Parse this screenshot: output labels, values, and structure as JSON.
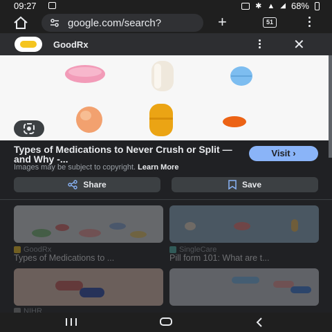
{
  "status_bar": {
    "time": "09:27",
    "battery": "68%"
  },
  "browser": {
    "url": "google.com/search?",
    "tab_count": "51"
  },
  "result_panel": {
    "site_name": "GoodRx",
    "title": "Types of Medications to Never Crush or Split — and Why -...",
    "visit_label": "Visit",
    "copyright_text": "Images may be subject to copyright.",
    "learn_more": "Learn More",
    "share_label": "Share",
    "save_label": "Save"
  },
  "related": [
    {
      "source": "GoodRx",
      "title": "Types of Medications to ...",
      "fav_color": "#f5c51f"
    },
    {
      "source": "SingleCare",
      "title": "Pill form 101: What are t...",
      "fav_color": "#4db6ac"
    },
    {
      "source": "NIHR"
    },
    {
      "source": ""
    }
  ],
  "colors": {
    "accent": "#8ab4f8",
    "background": "#202124"
  }
}
